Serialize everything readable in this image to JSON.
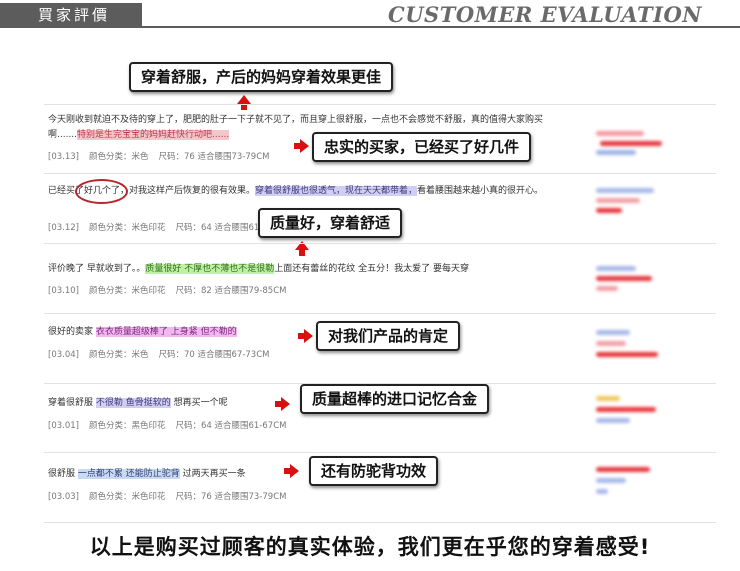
{
  "header": {
    "title_cn": "買家評價",
    "title_en": "CUSTOMER EVALUATION"
  },
  "callouts": [
    "穿着舒服，产后的妈妈穿着效果更佳",
    "忠实的买家，已经买了好几件",
    "质量好，穿着舒适",
    "对我们产品的肯定",
    "质量超棒的进口记忆合金",
    "还有防驼背功效"
  ],
  "reviews": [
    {
      "text_before": "今天刚收到就迫不及待的穿上了，肥肥的肚子一下子就不见了，而且穿上很舒服，一点也不会感觉不舒服，真的值得大家购买啊.......",
      "highlight": "特别是生完宝宝的妈妈赶快行动吧......",
      "text_after": "",
      "date": "[03.13]",
      "color": "颜色分类：米色",
      "size": "尺码：76 适合腰围73-79CM"
    },
    {
      "text_before": "已经买了好几个了，对我这样产后恢复的很有效果。",
      "highlight": "穿着很舒服也很透气，现在天天都带着，",
      "text_after": "看着腰围越来越小真的很开心。",
      "date": "[03.12]",
      "color": "颜色分类：米色印花",
      "size": "尺码：64 适合腰围61-67CM"
    },
    {
      "text_before": "评价晚了 早就收到了。。",
      "highlight": "质量很好 不厚也不薄也不是很勒",
      "text_after": "上面还有蕾丝的花纹 全五分！我太爱了 要每天穿",
      "date": "[03.10]",
      "color": "颜色分类：米色印花",
      "size": "尺码：82 适合腰围79-85CM"
    },
    {
      "text_before": "很好的卖家",
      "highlight": "衣衣质量超级棒了 上身紧 但不勒的",
      "text_after": "",
      "date": "[03.04]",
      "color": "颜色分类：米色",
      "size": "尺码：70 适合腰围67-73CM"
    },
    {
      "text_before": "穿着很舒服",
      "highlight": "不很勒 鱼骨挺软的",
      "text_after": "想再买一个呢",
      "date": "[03.01]",
      "color": "颜色分类：黑色印花",
      "size": "尺码：64 适合腰围61-67CM"
    },
    {
      "text_before": "很舒服",
      "highlight": "一点都不累 还能防止驼背",
      "text_after": "过两天再买一条",
      "date": "[03.03]",
      "color": "颜色分类：米色印花",
      "size": "尺码：76 适合腰围73-79CM"
    }
  ],
  "footer": "以上是购买过顾客的真实体验，我们更在乎您的穿着感受!"
}
